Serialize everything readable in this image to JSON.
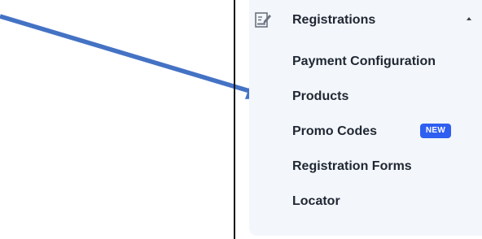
{
  "nav": {
    "section_label": "Registrations",
    "section_icon": "form-edit-icon",
    "expanded": true,
    "items": [
      {
        "label": "Payment Configuration"
      },
      {
        "label": "Products"
      },
      {
        "label": "Promo Codes",
        "badge": "NEW"
      },
      {
        "label": "Registration Forms"
      },
      {
        "label": "Locator"
      }
    ]
  },
  "colors": {
    "arrow": "#4472c4",
    "panel_background": "#f3f6fa",
    "text": "#1f2733",
    "badge": "#2f5ff1"
  }
}
